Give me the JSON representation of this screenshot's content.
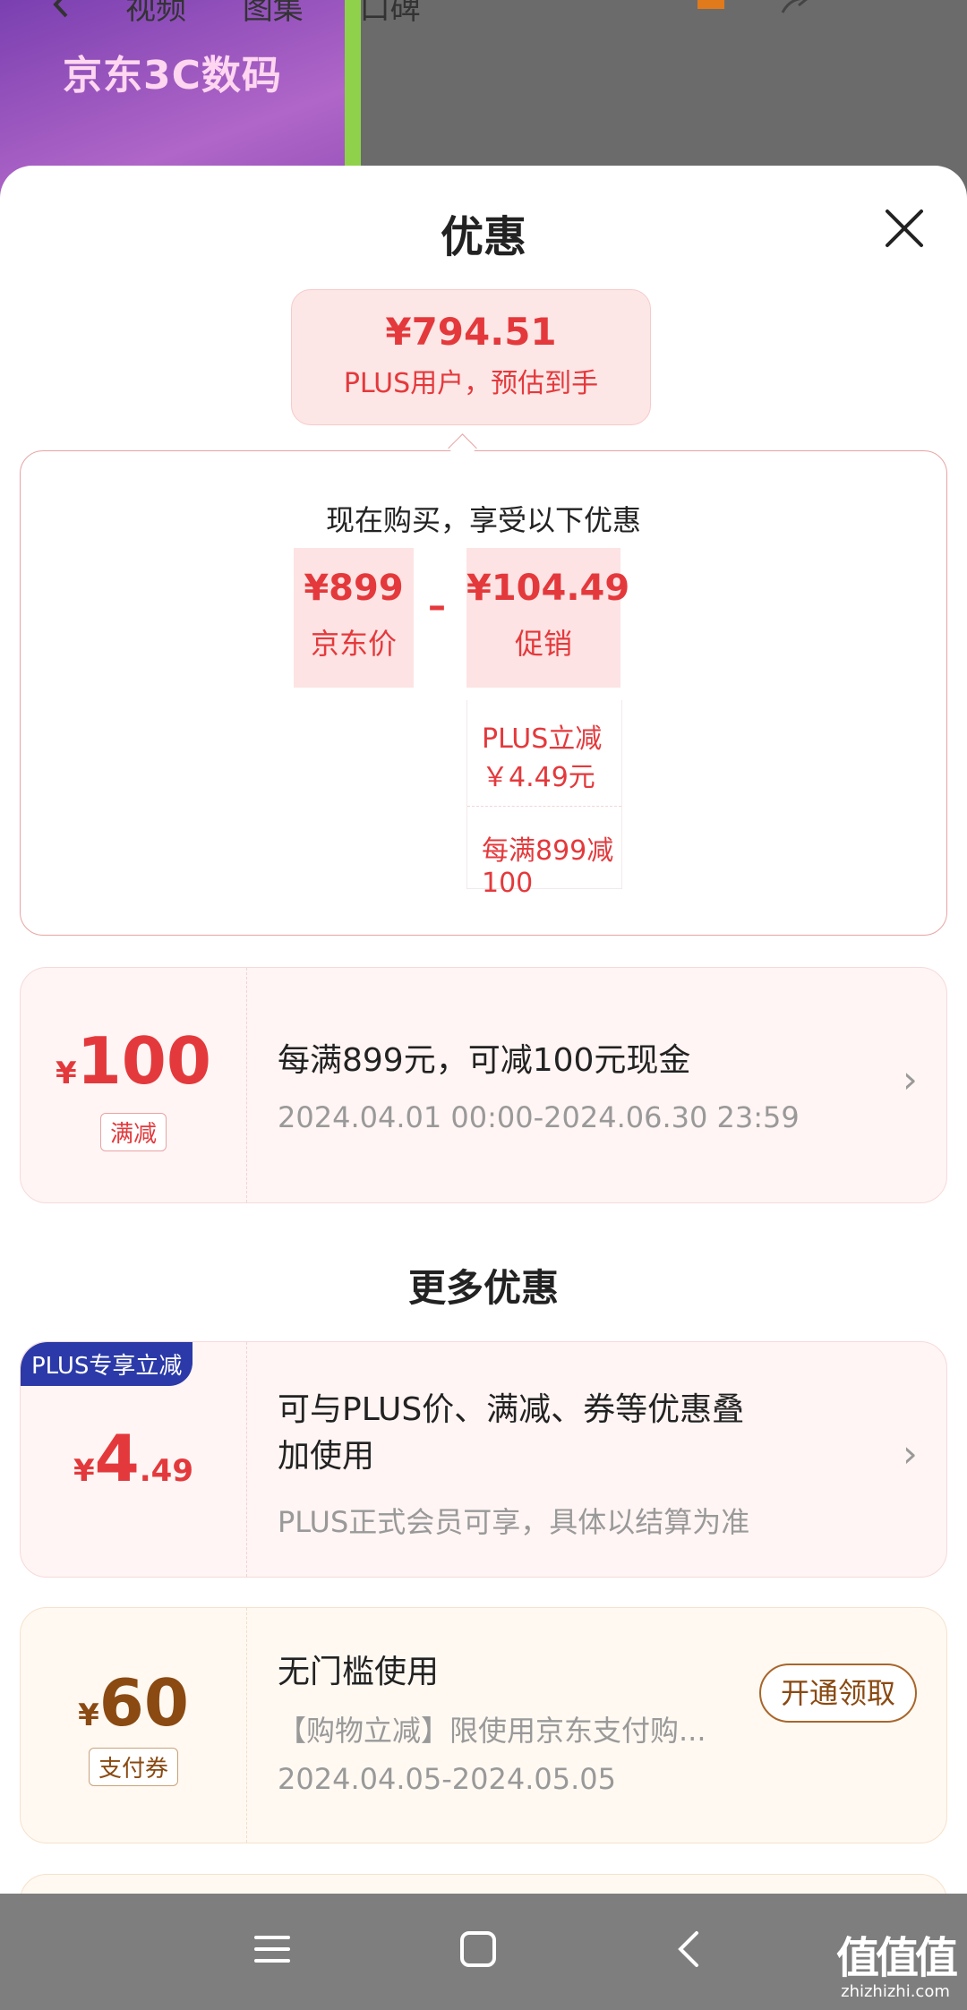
{
  "background": {
    "banner_title": "京东3C数码",
    "tabs": [
      "视频",
      "图集",
      "口碑"
    ]
  },
  "sheet": {
    "title": "优惠",
    "estimate": {
      "price": "¥794.51",
      "label": "PLUS用户，预估到手"
    },
    "detail": {
      "heading": "现在购买，享受以下优惠",
      "jd_price": {
        "value": "¥899",
        "label": "京东价"
      },
      "minus_sign": "–",
      "promo": {
        "value": "¥104.49",
        "label": "促销"
      },
      "sub_items": [
        "PLUS立减\n￥4.49元",
        "每满899减100"
      ]
    },
    "promo_card": {
      "currency": "¥",
      "amount": "100",
      "tag": "满减",
      "main_text": "每满899元，可减100元现金",
      "date_range": "2024.04.01 00:00-2024.06.30 23:59"
    },
    "more_title": "更多优惠",
    "plus_card": {
      "badge": "PLUS专享立减",
      "currency": "¥",
      "amount_int": "4",
      "amount_dec": ".49",
      "main_text_line1": "可与PLUS价、满减、券等优惠叠",
      "main_text_line2": "加使用",
      "sub_text": "PLUS正式会员可享，具体以结算为准"
    },
    "pay_card": {
      "currency": "¥",
      "amount": "60",
      "tag": "支付券",
      "main_text": "无门槛使用",
      "desc": "【购物立减】限使用京东支付购...",
      "date_range": "2024.04.05-2024.05.05",
      "button": "开通领取"
    }
  },
  "watermark": {
    "logo": "值值值",
    "site": "zhizhizhi.com"
  },
  "colors": {
    "accent": "#e4393c",
    "plus_badge": "#2b3aa8",
    "pay_brown": "#8a4a12"
  }
}
